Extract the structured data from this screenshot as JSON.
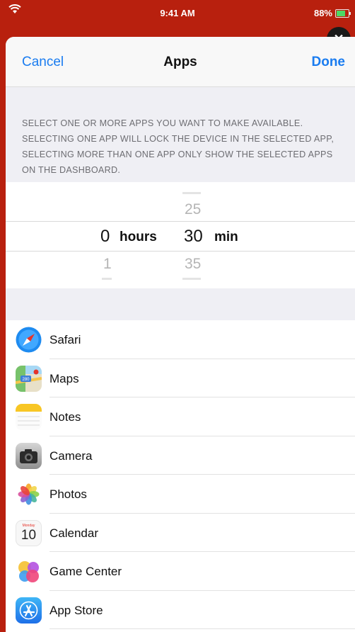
{
  "status_bar": {
    "time": "9:41 AM",
    "battery": "88%"
  },
  "nav": {
    "cancel_label": "Cancel",
    "title": "Apps",
    "done_label": "Done"
  },
  "info_text": "SELECT ONE OR MORE APPS YOU WANT TO MAKE AVAILABLE. SELECTING ONE APP WILL LOCK THE DEVICE IN THE SELECTED APP, SELECTING MORE THAN ONE APP ONLY SHOW THE SELECTED APPS ON THE DASHBOARD.",
  "picker": {
    "hours": {
      "selected": "0",
      "below": "1",
      "unit": "hours"
    },
    "minutes": {
      "above": "25",
      "selected": "30",
      "below": "35",
      "unit": "min"
    }
  },
  "apps": [
    {
      "label": "Safari",
      "icon": "safari-icon"
    },
    {
      "label": "Maps",
      "icon": "maps-icon",
      "badge": "280"
    },
    {
      "label": "Notes",
      "icon": "notes-icon"
    },
    {
      "label": "Camera",
      "icon": "camera-icon"
    },
    {
      "label": "Photos",
      "icon": "photos-icon"
    },
    {
      "label": "Calendar",
      "icon": "calendar-icon",
      "weekday": "Monday",
      "day": "10"
    },
    {
      "label": "Game Center",
      "icon": "game-center-icon"
    },
    {
      "label": "App Store",
      "icon": "app-store-icon"
    }
  ],
  "colors": {
    "accent": "#1a7cf0",
    "header_bg": "#b8200e",
    "group_bg": "#efeff4"
  }
}
